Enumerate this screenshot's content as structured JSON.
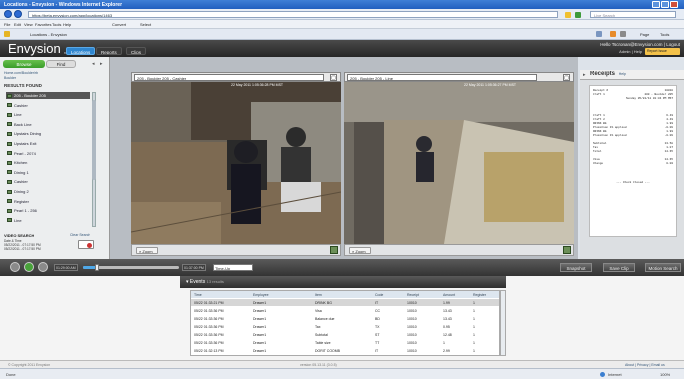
{
  "browser": {
    "title": "Locations - Envysion - Windows Internet Explorer",
    "url": "https://beta.envysion.com/app/locations/1463",
    "search_placeholder": "Live Search",
    "menus": [
      "File",
      "Edit",
      "View",
      "Favorites",
      "Tools",
      "Help"
    ],
    "extra_toolbar": [
      "Convert",
      "Select"
    ],
    "favorites_tab": "Locations - Envysion",
    "tools_buttons": [
      "Page",
      "Tools"
    ],
    "status_left": "Done",
    "status_zone": "Internet",
    "status_zoom": "100%"
  },
  "app": {
    "logo": "Envysion",
    "logo_sub": "BETA",
    "tabs": [
      "Locations",
      "Reports",
      "Clips"
    ],
    "user_line": "Hello Tscronan@Envysion.com | Logout",
    "help_line": "Admin | Help",
    "report_button": "Report Issue"
  },
  "sidebar": {
    "browse_tab": "Browse",
    "find_tab": "Find",
    "crumbs": [
      "Home.com/Boulder/rb",
      "Boulder"
    ],
    "results_header": "RESULTS FOUND",
    "locations": [
      {
        "label": "205 - Boulder 205",
        "selected": true
      },
      {
        "label": "Cashier",
        "selected": false
      },
      {
        "label": "Line",
        "selected": false
      },
      {
        "label": "Back Line",
        "selected": false
      },
      {
        "label": "Upstairs Dining",
        "selected": false
      },
      {
        "label": "Upstairs Exit",
        "selected": false
      },
      {
        "label": "Pearl - 2074",
        "selected": false
      },
      {
        "label": "Kitchen",
        "selected": false
      },
      {
        "label": "Dining 1",
        "selected": false
      },
      {
        "label": "Cashier",
        "selected": false
      },
      {
        "label": "Dining 2",
        "selected": false
      },
      {
        "label": "Register",
        "selected": false
      },
      {
        "label": "Pearl 1 - 256",
        "selected": false
      },
      {
        "label": "Line",
        "selected": false
      }
    ],
    "video_search_header": "VIDEO SEARCH",
    "video_search_clear": "Clear Search",
    "video_search_lines": [
      "Date & Time",
      "05/22/2011 - 07:17:50 PM",
      "05/22/2011 - 07:17:50 PM"
    ]
  },
  "cameras": [
    {
      "title": "205 - Boulder 205 - Cashier",
      "timestamp": "22 May 2011 1:05:36:28 PM MST",
      "zoom": "Zoom"
    },
    {
      "title": "205 - Boulder 205 - Line",
      "timestamp": "22 May 2011 1:05:36:27 PM MST",
      "zoom": "Zoom"
    }
  ],
  "receipts": {
    "title": "Receipts",
    "title_suffix": "Help",
    "lines": [
      {
        "k": "Receipt #",
        "v": "10010"
      },
      {
        "k": "Craft 1",
        "v": "200 - Boulder 205"
      },
      {
        "k": "",
        "v": "Sunday 05/22/11 01:34 PM MST"
      },
      {
        "k": "Craft 1",
        "v": "6.49"
      },
      {
        "k": "Craft 2",
        "v": "4.49"
      },
      {
        "k": "DRINK BG",
        "v": "1.99"
      },
      {
        "k": "Promotion 1% applied",
        "v": "-0.09"
      },
      {
        "k": "DRINK BG",
        "v": "1.99"
      },
      {
        "k": "Promotion 1% applied",
        "v": "-0.09"
      },
      {
        "k": "Subtotal",
        "v": "13.58"
      },
      {
        "k": "Tax",
        "v": "1.07"
      },
      {
        "k": "Total",
        "v": "14.65"
      },
      {
        "k": "Visa",
        "v": "14.65"
      },
      {
        "k": "Change",
        "v": "0.00"
      }
    ],
    "footer": "--- Check Closed ---"
  },
  "timeline": {
    "start_time": "01:29:00 AM",
    "end_time": "01:37:00 PM",
    "mode": "Time-Up",
    "position_fraction": 0.15,
    "buttons": [
      "Snapshot",
      "Save Clip",
      "Motion Search"
    ]
  },
  "events": {
    "header": "Events",
    "count": "13 results",
    "columns": [
      "Time",
      "Employee",
      "Item",
      "Code",
      "Receipt",
      "Amount",
      "Register"
    ],
    "rows": [
      [
        "05/22 01:33:21 PM",
        "Drawer1",
        "DRINK BG",
        "IT",
        "10010",
        "1.99",
        "1"
      ],
      [
        "05/22 01:33:36 PM",
        "Drawer1",
        "Visa",
        "CC",
        "10010",
        "13.43",
        "1"
      ],
      [
        "05/22 01:33:36 PM",
        "Drawer1",
        "Balance due",
        "BD",
        "10010",
        "13.43",
        "1"
      ],
      [
        "05/22 01:33:36 PM",
        "Drawer1",
        "Tax",
        "TX",
        "10010",
        "0.95",
        "1"
      ],
      [
        "05/22 01:33:36 PM",
        "Drawer1",
        "Subtotal",
        "ST",
        "10010",
        "12.48",
        "1"
      ],
      [
        "05/22 01:33:36 PM",
        "Drawer1",
        "Table size",
        "TT",
        "10010",
        "1",
        "1"
      ],
      [
        "05/22 01:32:13 PM",
        "Drawer1",
        "DORIT COOMB",
        "IT",
        "10010",
        "2.99",
        "1"
      ]
    ]
  },
  "footer": {
    "copyright": "© Copyright 2011 Envysion",
    "version": "version 05.13.11 (3.0.5)",
    "links": "About | Privacy | Email us"
  }
}
